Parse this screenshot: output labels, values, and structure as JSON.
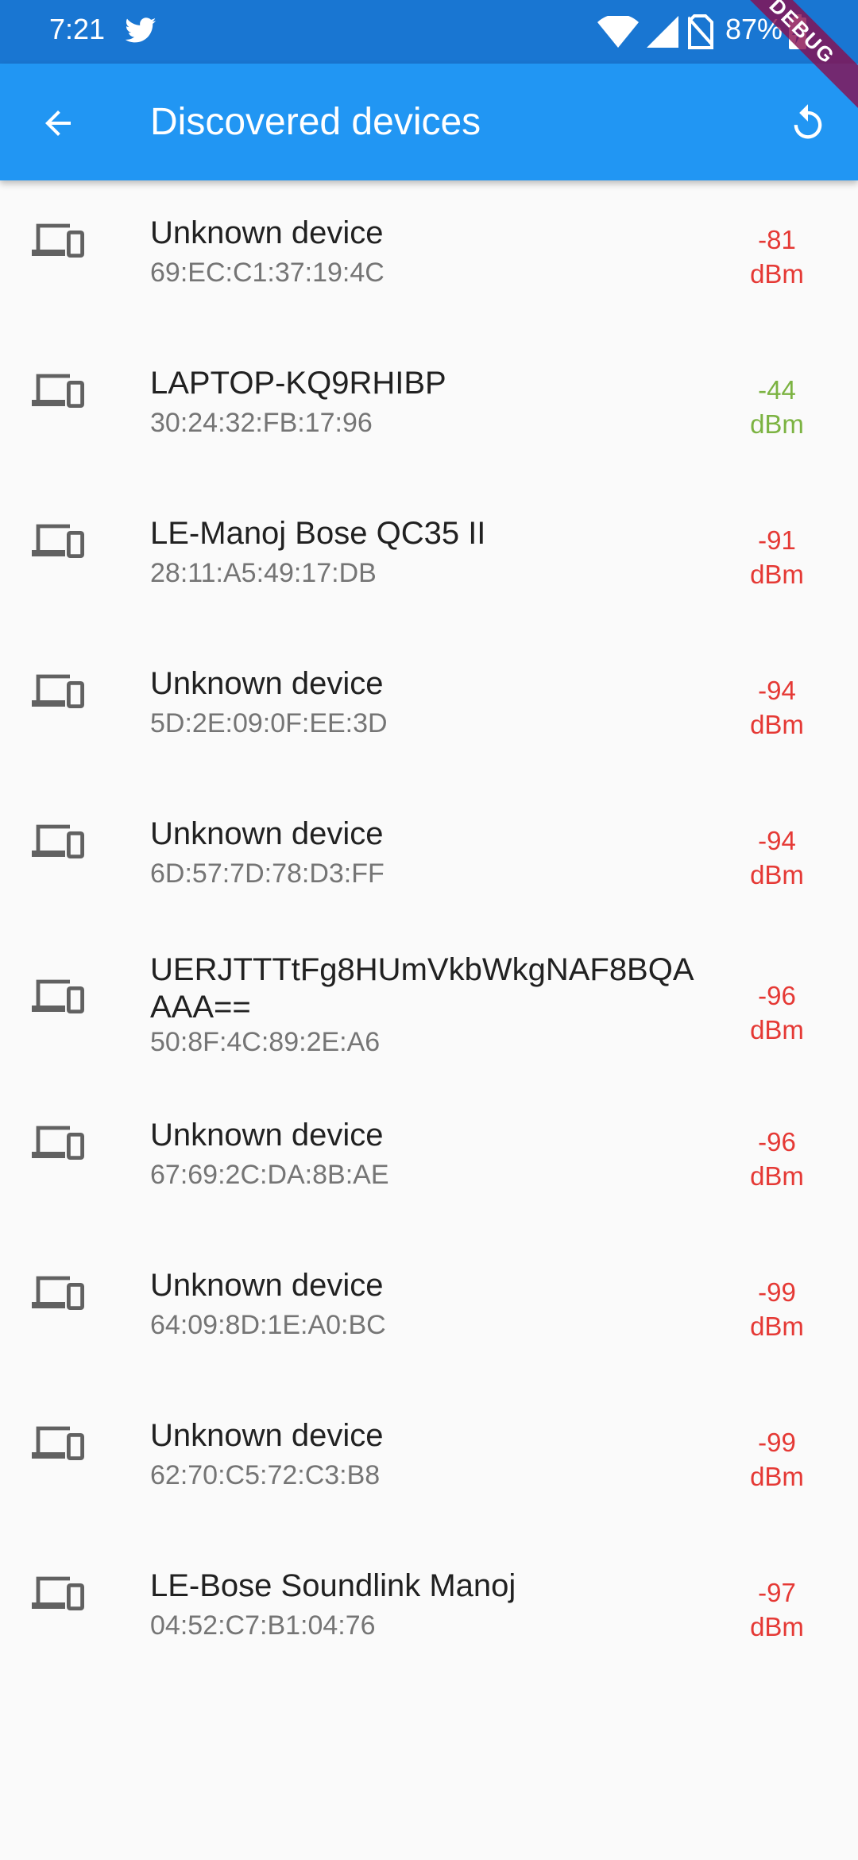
{
  "status_bar": {
    "time": "7:21",
    "battery": "87%",
    "icons": [
      "twitter-icon",
      "wifi-icon",
      "signal-icon",
      "no-sim-icon",
      "battery-charging-icon"
    ]
  },
  "app_bar": {
    "title": "Discovered devices",
    "back_icon": "arrow-back-icon",
    "refresh_icon": "refresh-icon",
    "color": "#2196f3"
  },
  "debug_banner": "DEBUG",
  "colors": {
    "weak_signal": "#e53935",
    "strong_signal": "#7cb342"
  },
  "devices": [
    {
      "name": "Unknown device",
      "address": "69:EC:C1:37:19:4C",
      "rssi": "-81",
      "unit": "dBm"
    },
    {
      "name": "LAPTOP-KQ9RHIBP",
      "address": "30:24:32:FB:17:96",
      "rssi": "-44",
      "unit": "dBm"
    },
    {
      "name": "LE-Manoj Bose QC35 II",
      "address": "28:11:A5:49:17:DB",
      "rssi": "-91",
      "unit": "dBm"
    },
    {
      "name": "Unknown device",
      "address": "5D:2E:09:0F:EE:3D",
      "rssi": "-94",
      "unit": "dBm"
    },
    {
      "name": "Unknown device",
      "address": "6D:57:7D:78:D3:FF",
      "rssi": "-94",
      "unit": "dBm"
    },
    {
      "name": "UERJTTTtFg8HUmVkbWkgNAF8BQAAAA==",
      "address": "50:8F:4C:89:2E:A6",
      "rssi": "-96",
      "unit": "dBm"
    },
    {
      "name": "Unknown device",
      "address": "67:69:2C:DA:8B:AE",
      "rssi": "-96",
      "unit": "dBm"
    },
    {
      "name": "Unknown device",
      "address": "64:09:8D:1E:A0:BC",
      "rssi": "-99",
      "unit": "dBm"
    },
    {
      "name": "Unknown device",
      "address": "62:70:C5:72:C3:B8",
      "rssi": "-99",
      "unit": "dBm"
    },
    {
      "name": "LE-Bose Soundlink Manoj",
      "address": "04:52:C7:B1:04:76",
      "rssi": "-97",
      "unit": "dBm"
    }
  ]
}
